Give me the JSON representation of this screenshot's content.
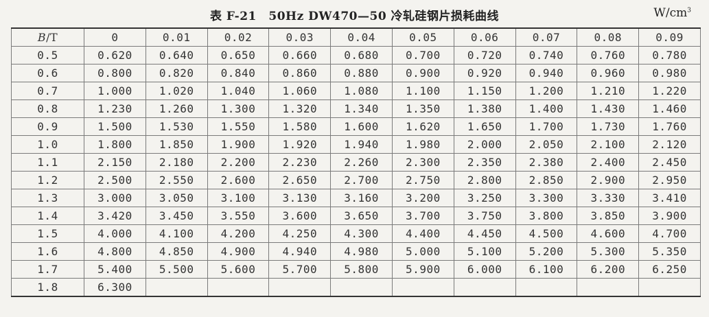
{
  "title": "表 F-21　50Hz DW470—50 冷轧硅钢片损耗曲线",
  "unit": {
    "base": "W/cm",
    "exponent": "3"
  },
  "table": {
    "corner_var": "B",
    "corner_unit": "/T",
    "column_headers": [
      "0",
      "0.01",
      "0.02",
      "0.03",
      "0.04",
      "0.05",
      "0.06",
      "0.07",
      "0.08",
      "0.09"
    ],
    "rows": [
      {
        "b": "0.5",
        "values": [
          "0.620",
          "0.640",
          "0.650",
          "0.660",
          "0.680",
          "0.700",
          "0.720",
          "0.740",
          "0.760",
          "0.780"
        ]
      },
      {
        "b": "0.6",
        "values": [
          "0.800",
          "0.820",
          "0.840",
          "0.860",
          "0.880",
          "0.900",
          "0.920",
          "0.940",
          "0.960",
          "0.980"
        ]
      },
      {
        "b": "0.7",
        "values": [
          "1.000",
          "1.020",
          "1.040",
          "1.060",
          "1.080",
          "1.100",
          "1.150",
          "1.200",
          "1.210",
          "1.220"
        ]
      },
      {
        "b": "0.8",
        "values": [
          "1.230",
          "1.260",
          "1.300",
          "1.320",
          "1.340",
          "1.350",
          "1.380",
          "1.400",
          "1.430",
          "1.460"
        ]
      },
      {
        "b": "0.9",
        "values": [
          "1.500",
          "1.530",
          "1.550",
          "1.580",
          "1.600",
          "1.620",
          "1.650",
          "1.700",
          "1.730",
          "1.760"
        ]
      },
      {
        "b": "1.0",
        "values": [
          "1.800",
          "1.850",
          "1.900",
          "1.920",
          "1.940",
          "1.980",
          "2.000",
          "2.050",
          "2.100",
          "2.120"
        ]
      },
      {
        "b": "1.1",
        "values": [
          "2.150",
          "2.180",
          "2.200",
          "2.230",
          "2.260",
          "2.300",
          "2.350",
          "2.380",
          "2.400",
          "2.450"
        ]
      },
      {
        "b": "1.2",
        "values": [
          "2.500",
          "2.550",
          "2.600",
          "2.650",
          "2.700",
          "2.750",
          "2.800",
          "2.850",
          "2.900",
          "2.950"
        ]
      },
      {
        "b": "1.3",
        "values": [
          "3.000",
          "3.050",
          "3.100",
          "3.130",
          "3.160",
          "3.200",
          "3.250",
          "3.300",
          "3.330",
          "3.410"
        ]
      },
      {
        "b": "1.4",
        "values": [
          "3.420",
          "3.450",
          "3.550",
          "3.600",
          "3.650",
          "3.700",
          "3.750",
          "3.800",
          "3.850",
          "3.900"
        ]
      },
      {
        "b": "1.5",
        "values": [
          "4.000",
          "4.100",
          "4.200",
          "4.250",
          "4.300",
          "4.400",
          "4.450",
          "4.500",
          "4.600",
          "4.700"
        ]
      },
      {
        "b": "1.6",
        "values": [
          "4.800",
          "4.850",
          "4.900",
          "4.940",
          "4.980",
          "5.000",
          "5.100",
          "5.200",
          "5.300",
          "5.350"
        ]
      },
      {
        "b": "1.7",
        "values": [
          "5.400",
          "5.500",
          "5.600",
          "5.700",
          "5.800",
          "5.900",
          "6.000",
          "6.100",
          "6.200",
          "6.250"
        ]
      },
      {
        "b": "1.8",
        "values": [
          "6.300",
          "",
          "",
          "",
          "",
          "",
          "",
          "",
          "",
          ""
        ]
      }
    ]
  }
}
